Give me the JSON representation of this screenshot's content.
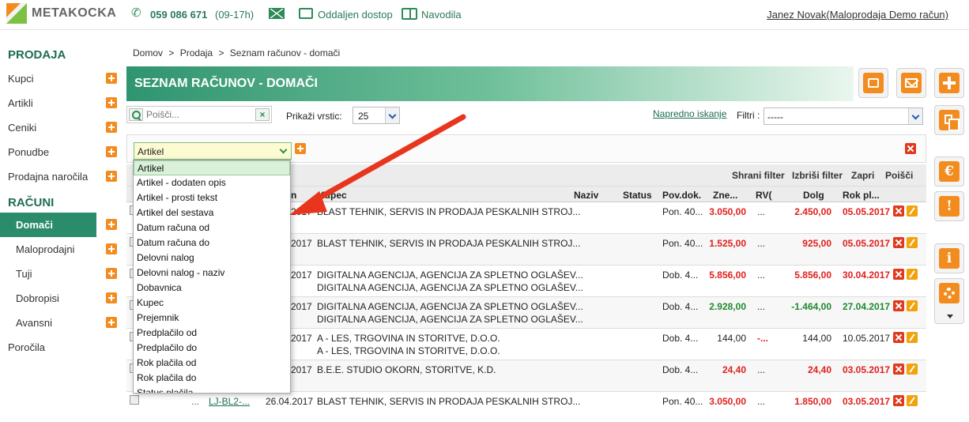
{
  "header": {
    "logo_text": "METAKOCKA",
    "phone": "059 086 671",
    "phone_hours": "(09-17h)",
    "remote": "Oddaljen dostop",
    "manual": "Navodila",
    "user": "Janez Novak(Maloprodaja Demo račun)"
  },
  "sidebar": {
    "heading_prodaja": "PRODAJA",
    "prodaja_items": [
      "Kupci",
      "Artikli",
      "Ceniki",
      "Ponudbe",
      "Prodajna naročila"
    ],
    "heading_racuni": "RAČUNI",
    "racuni_items": [
      "Domači",
      "Maloprodajni",
      "Tuji",
      "Dobropisi",
      "Avansni"
    ],
    "porocila": "Poročila"
  },
  "breadcrumb": {
    "home": "Domov",
    "sep": ">",
    "section": "Prodaja",
    "page": "Seznam računov - domači"
  },
  "title": "SEZNAM RAČUNOV - DOMAČI",
  "toolbar": {
    "search_placeholder": "Poišči...",
    "clear": "×",
    "rows_label": "Prikaži vrstic:",
    "rows_value": "25",
    "advanced": "Napredno iskanje",
    "filters_label": "Filtri :",
    "filters_value": "-----"
  },
  "filter": {
    "field_value": "Artikel",
    "actions": [
      "Shrani filter",
      "Izbriši filter",
      "Zapri",
      "Poišči"
    ]
  },
  "dropdown_options": [
    "Artikel",
    "Artikel - dodaten opis",
    "Artikel - prosti tekst",
    "Artikel del sestava",
    "Datum računa od",
    "Datum računa do",
    "Delovni nalog",
    "Delovni nalog - naziv",
    "Dobavnica",
    "Kupec",
    "Prejemnik",
    "Predplačilo od",
    "Predplačilo do",
    "Rok plačila od",
    "Rok plačila do",
    "Status plačila"
  ],
  "table": {
    "headers": {
      "date": "n",
      "kupec": "Kupec",
      "naziv": "Naziv",
      "status": "Status",
      "povdok": "Pov.dok.",
      "znesek": "Zne...",
      "rvc": "RV(",
      "dolg": "Dolg",
      "rok": "Rok pl..."
    },
    "rows": [
      {
        "id": "",
        "date": "2017",
        "kupec1": "BLAST TEHNIK, SERVIS IN PRODAJA PESKALNIH STROJ...",
        "kupec2": "",
        "pov": "Pon. 40...",
        "znesek": "3.050,00",
        "rvc": "...",
        "dolg": "2.450,00",
        "rok": "05.05.2017",
        "zcls": "neg-red",
        "dcls": "neg-red",
        "rcls": "neg-red"
      },
      {
        "id": "",
        "date": "2017",
        "kupec1": "BLAST TEHNIK, SERVIS IN PRODAJA PESKALNIH STROJ...",
        "kupec2": "",
        "pov": "Pon. 40...",
        "znesek": "1.525,00",
        "rvc": "...",
        "dolg": "925,00",
        "rok": "05.05.2017",
        "zcls": "neg-red",
        "dcls": "neg-red",
        "rcls": "neg-red"
      },
      {
        "id": "",
        "date": "2017",
        "kupec1": "DIGITALNA AGENCIJA, AGENCIJA ZA SPLETNO OGLAŠEV...",
        "kupec2": "DIGITALNA AGENCIJA, AGENCIJA ZA SPLETNO OGLAŠEV...",
        "pov": "Dob. 4...",
        "znesek": "5.856,00",
        "rvc": "...",
        "dolg": "5.856,00",
        "rok": "30.04.2017",
        "zcls": "neg-red",
        "dcls": "neg-red",
        "rcls": "neg-red"
      },
      {
        "id": "",
        "date": "2017",
        "kupec1": "DIGITALNA AGENCIJA, AGENCIJA ZA SPLETNO OGLAŠEV...",
        "kupec2": "DIGITALNA AGENCIJA, AGENCIJA ZA SPLETNO OGLAŠEV...",
        "pov": "Dob. 4...",
        "znesek": "2.928,00",
        "rvc": "...",
        "dolg": "-1.464,00",
        "rok": "27.04.2017",
        "zcls": "pos-green",
        "dcls": "pos-green",
        "rcls": "pos-green"
      },
      {
        "id": "",
        "date": "2017",
        "kupec1": "A - LES, TRGOVINA IN STORITVE, D.O.O.",
        "kupec2": "A - LES, TRGOVINA IN STORITVE, D.O.O.",
        "pov": "Dob. 4...",
        "znesek": "144,00",
        "rvc": "-...",
        "dolg": "144,00",
        "rok": "10.05.2017",
        "zcls": "",
        "dcls": "",
        "rcls": ""
      },
      {
        "id": "",
        "date": "2017",
        "kupec1": "B.E.E. STUDIO OKORN, STORITVE, K.D.",
        "kupec2": "",
        "pov": "Dob. 4...",
        "znesek": "24,40",
        "rvc": "...",
        "dolg": "24,40",
        "rok": "03.05.2017",
        "zcls": "neg-red",
        "dcls": "neg-red",
        "rcls": "neg-red"
      },
      {
        "id": "LJ-BL2-...",
        "date": "26.04.2017",
        "kupec1": "BLAST TEHNIK, SERVIS IN PRODAJA PESKALNIH STROJ...",
        "kupec2": "",
        "pov": "Pon. 40...",
        "znesek": "3.050,00",
        "rvc": "...",
        "dolg": "1.850,00",
        "rok": "03.05.2017",
        "zcls": "neg-red",
        "dcls": "neg-red",
        "rcls": "neg-red"
      }
    ]
  },
  "row_prefix": "...",
  "colors": {
    "accent": "#2b8c6b",
    "orange": "#f28c1f",
    "red": "#e0201d",
    "green": "#1f8a2e"
  }
}
